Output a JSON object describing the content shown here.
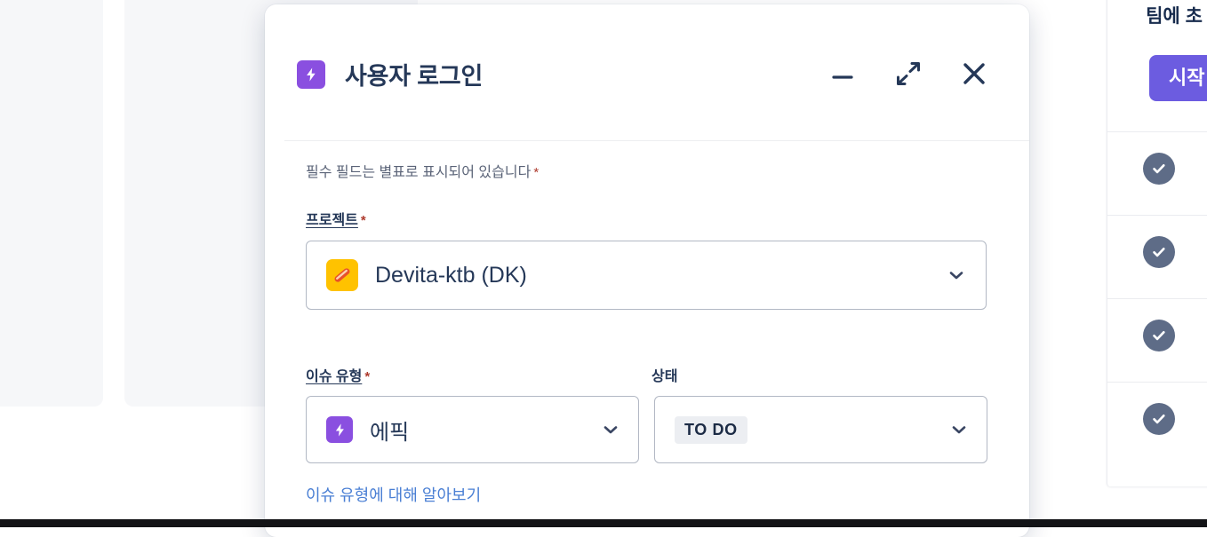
{
  "background": {
    "cards": [
      "card-left",
      "card-right"
    ]
  },
  "right_panel": {
    "heading": "팀에 초",
    "cta_label": "시작",
    "rows": [
      {
        "icon": "check-circle-icon"
      },
      {
        "icon": "check-circle-icon"
      },
      {
        "icon": "check-circle-icon"
      },
      {
        "icon": "check-circle-icon"
      }
    ]
  },
  "modal": {
    "title": "사용자 로그인",
    "title_icon": "epic-bolt-icon",
    "actions": {
      "minimize": "minimize-icon",
      "expand": "expand-icon",
      "close": "close-icon"
    },
    "required_note": "필수 필드는 별표로 표시되어 있습니다",
    "required_marker": "*",
    "fields": {
      "project": {
        "label": "프로젝트",
        "required": true,
        "value": "Devita-ktb (DK)",
        "avatar_icon": "project-avatar-icon",
        "chevron": "chevron-down-icon"
      },
      "issue_type": {
        "label": "이슈 유형",
        "required": true,
        "value": "에픽",
        "icon": "epic-bolt-icon",
        "chevron": "chevron-down-icon"
      },
      "status": {
        "label": "상태",
        "required": false,
        "value": "TO DO",
        "chevron": "chevron-down-icon"
      }
    },
    "issue_type_link": "이슈 유형에 대해 알아보기"
  },
  "colors": {
    "epic_purple": "#8a4fe0",
    "cta_purple": "#6c5ce0",
    "required_red": "#ae3b2e",
    "link_blue": "#4a7fd4",
    "text_dark": "#253858",
    "project_avatar_yellow": "#ffc200",
    "lozenge_grey": "#eceef2",
    "check_circle_grey": "#5e6c87"
  }
}
